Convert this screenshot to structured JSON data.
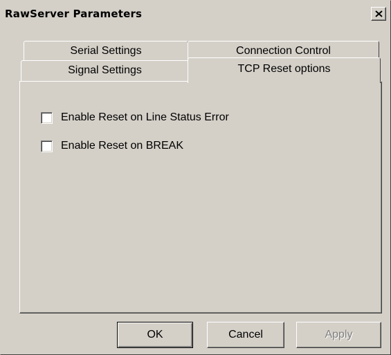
{
  "window": {
    "title": "RawServer Parameters"
  },
  "tabs": {
    "row_back": [
      {
        "label": "Serial Settings"
      },
      {
        "label": "Connection Control"
      }
    ],
    "row_front": [
      {
        "label": "Signal Settings"
      },
      {
        "label": "TCP Reset options"
      }
    ],
    "selected": "TCP Reset options"
  },
  "options": [
    {
      "label": "Enable Reset on Line Status Error",
      "checked": false
    },
    {
      "label": "Enable Reset on BREAK",
      "checked": false
    }
  ],
  "buttons": {
    "ok": "OK",
    "cancel": "Cancel",
    "apply": "Apply",
    "apply_enabled": false
  },
  "icons": {
    "close": "close-icon"
  }
}
